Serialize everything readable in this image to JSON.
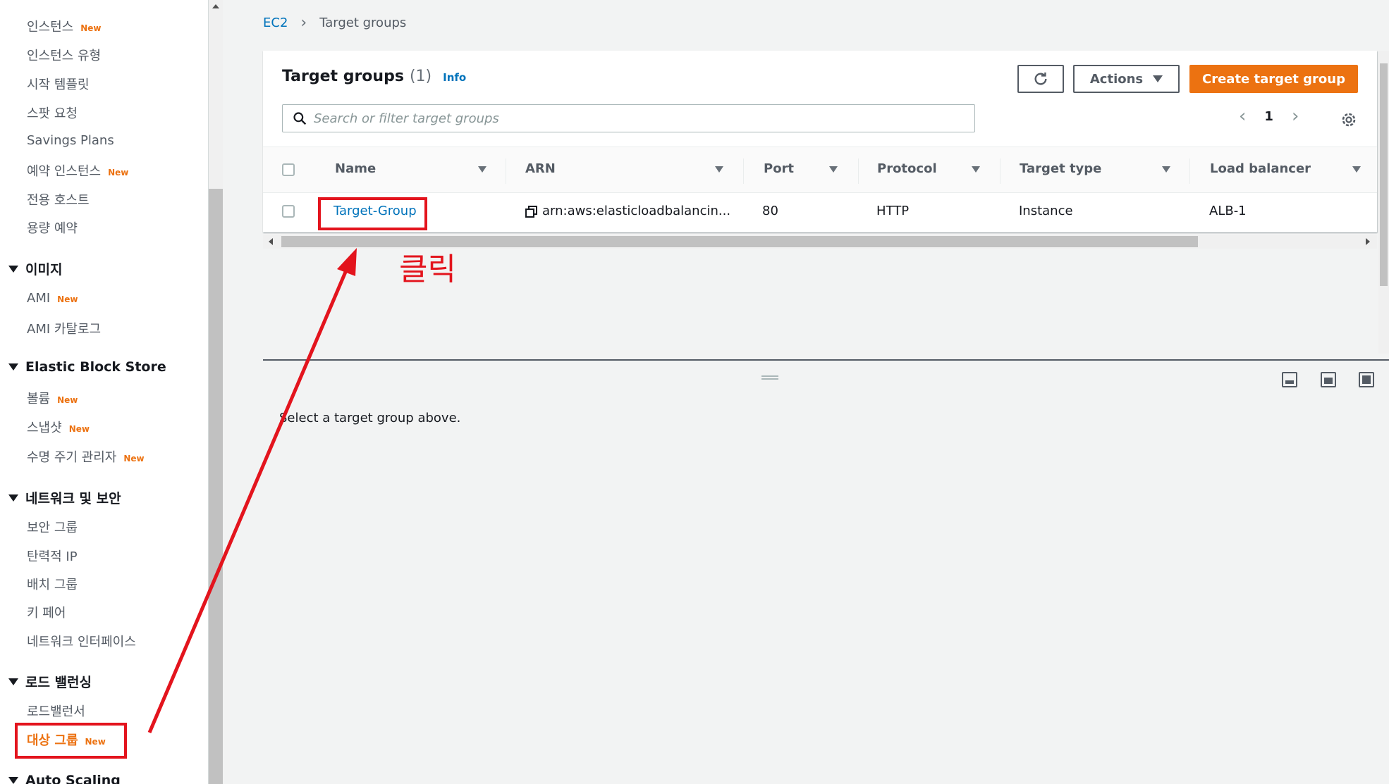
{
  "sidebar": {
    "sections": [
      {
        "title": "이미지",
        "items": [
          {
            "label": "AMI",
            "badge": "New"
          },
          {
            "label": "AMI 카탈로그",
            "badge": ""
          }
        ]
      },
      {
        "title": "Elastic Block Store",
        "items": [
          {
            "label": "볼륨",
            "badge": "New"
          },
          {
            "label": "스냅샷",
            "badge": "New"
          },
          {
            "label": "수명 주기 관리자",
            "badge": "New"
          }
        ]
      },
      {
        "title": "네트워크 및 보안",
        "items": [
          {
            "label": "보안 그룹",
            "badge": ""
          },
          {
            "label": "탄력적 IP",
            "badge": ""
          },
          {
            "label": "배치 그룹",
            "badge": ""
          },
          {
            "label": "키 페어",
            "badge": ""
          },
          {
            "label": "네트워크 인터페이스",
            "badge": ""
          }
        ]
      },
      {
        "title": "로드 밸런싱",
        "items": [
          {
            "label": "로드밸런서",
            "badge": ""
          },
          {
            "label": "대상 그룹",
            "badge": "New"
          }
        ]
      },
      {
        "title": "Auto Scaling"
      }
    ],
    "instance_items": [
      {
        "label": "인스턴스",
        "badge": "New"
      },
      {
        "label": "인스턴스 유형",
        "badge": ""
      },
      {
        "label": "시작 템플릿",
        "badge": ""
      },
      {
        "label": "스팟 요청",
        "badge": ""
      },
      {
        "label": "Savings Plans",
        "badge": ""
      },
      {
        "label": "예약 인스턴스",
        "badge": "New"
      },
      {
        "label": "전용 호스트",
        "badge": ""
      },
      {
        "label": "용량 예약",
        "badge": ""
      }
    ]
  },
  "breadcrumb": {
    "root": "EC2",
    "current": "Target groups"
  },
  "panel": {
    "title": "Target groups",
    "count": "(1)",
    "info": "Info",
    "actions_label": "Actions",
    "create_label": "Create target group",
    "search_placeholder": "Search or filter target groups",
    "page": "1"
  },
  "table": {
    "columns": [
      "Name",
      "ARN",
      "Port",
      "Protocol",
      "Target type",
      "Load balancer"
    ],
    "rows": [
      {
        "name": "Target-Group",
        "arn": "arn:aws:elasticloadbalancin...",
        "port": "80",
        "protocol": "HTTP",
        "target_type": "Instance",
        "load_balancer": "ALB-1"
      }
    ]
  },
  "detail": {
    "empty_message": "Select a target group above."
  },
  "annotation": {
    "text": "클릭"
  },
  "colors": {
    "accent": "#ec7211",
    "link": "#0073bb",
    "annotation": "#e3141d"
  }
}
